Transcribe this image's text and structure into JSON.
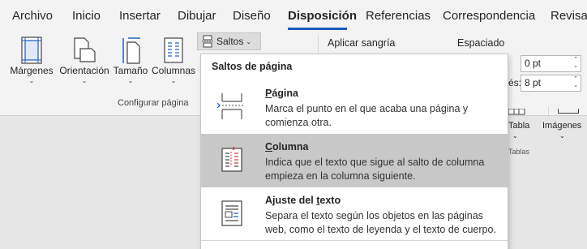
{
  "menu": {
    "tabs": [
      {
        "label": "Archivo"
      },
      {
        "label": "Inicio"
      },
      {
        "label": "Insertar"
      },
      {
        "label": "Dibujar"
      },
      {
        "label": "Diseño"
      },
      {
        "label": "Disposición"
      },
      {
        "label": "Referencias"
      },
      {
        "label": "Correspondencia"
      },
      {
        "label": "Revisa"
      }
    ],
    "active_tab": "Disposición",
    "accent": "#185abd"
  },
  "ribbon": {
    "buttons": [
      {
        "label": "Márgenes",
        "icon": "margins-icon"
      },
      {
        "label": "Orientación",
        "icon": "orientation-icon"
      },
      {
        "label": "Tamaño",
        "icon": "size-icon"
      },
      {
        "label": "Columnas",
        "icon": "columns-icon"
      }
    ],
    "group_label": "Configurar página",
    "saltos_label": "Saltos",
    "aplicar_sangria": "Aplicar sangría",
    "espaciado": "Espaciado",
    "spacing_before": "0 pt",
    "spacing_after_label": "és:",
    "spacing_after": "8 pt",
    "tabla_label": "Tabla",
    "imagenes_label": "Imágenes",
    "tablas_group": "Tablas"
  },
  "dropdown": {
    "header": "Saltos de página",
    "items": [
      {
        "title_prefix": "",
        "title_underlined": "P",
        "title_rest": "ágina",
        "description": "Marca el punto en el que acaba una página y comienza otra.",
        "icon": "page-break-icon",
        "selected": false
      },
      {
        "title_prefix": "",
        "title_underlined": "C",
        "title_rest": "olumna",
        "description": "Indica que el texto que sigue al salto de columna empieza en la columna siguiente.",
        "icon": "column-break-icon",
        "selected": true
      },
      {
        "title_prefix": "Ajuste del ",
        "title_underlined": "t",
        "title_rest": "exto",
        "description": "Separa el texto según los objetos en las páginas web, como el texto de leyenda y el texto de cuerpo.",
        "icon": "text-wrapping-icon",
        "selected": false
      }
    ]
  }
}
